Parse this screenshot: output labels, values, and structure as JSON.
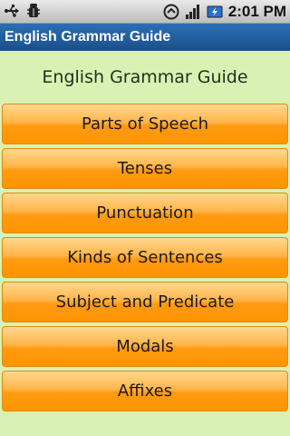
{
  "status_bar": {
    "time": "2:01 PM",
    "icons": [
      "usb-icon",
      "debug-icon",
      "sync-icon",
      "signal-icon",
      "battery-icon"
    ]
  },
  "app": {
    "title": "English Grammar Guide"
  },
  "main": {
    "heading": "English Grammar Guide",
    "menu_items": [
      {
        "label": "Parts of Speech"
      },
      {
        "label": "Tenses"
      },
      {
        "label": "Punctuation"
      },
      {
        "label": "Kinds of Sentences"
      },
      {
        "label": "Subject and Predicate"
      },
      {
        "label": "Modals"
      },
      {
        "label": "Affixes"
      }
    ]
  },
  "colors": {
    "background": "#d9f2b3",
    "title_bar": "#1f5c9b",
    "button": "#ffa726"
  }
}
